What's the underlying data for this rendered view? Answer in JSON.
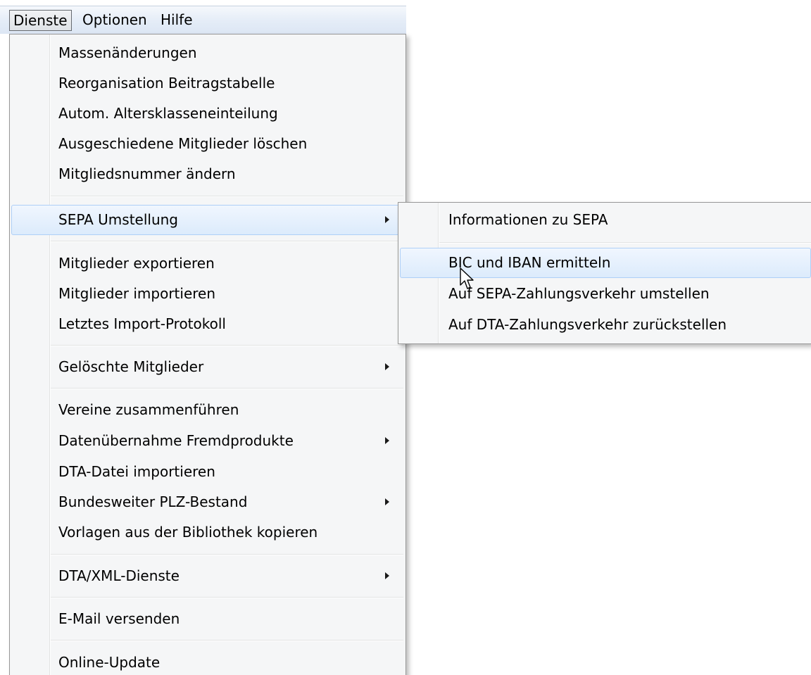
{
  "menubar": {
    "items": [
      {
        "label": "Dienste",
        "open": true
      },
      {
        "label": "Optionen",
        "open": false
      },
      {
        "label": "Hilfe",
        "open": false
      }
    ]
  },
  "dropdown": {
    "items": [
      {
        "label": "Massenänderungen"
      },
      {
        "label": "Reorganisation Beitragstabelle"
      },
      {
        "label": "Autom. Altersklasseneinteilung"
      },
      {
        "label": "Ausgeschiedene Mitglieder löschen"
      },
      {
        "label": "Mitgliedsnummer ändern"
      },
      {
        "label": "SEPA Umstellung",
        "submenu": true,
        "highlighted": true
      },
      {
        "label": "Mitglieder exportieren"
      },
      {
        "label": "Mitglieder importieren"
      },
      {
        "label": "Letztes Import-Protokoll"
      },
      {
        "label": "Gelöschte Mitglieder",
        "submenu": true
      },
      {
        "label": "Vereine zusammenführen"
      },
      {
        "label": "Datenübernahme Fremdprodukte",
        "submenu": true
      },
      {
        "label": "DTA-Datei importieren"
      },
      {
        "label": "Bundesweiter PLZ-Bestand",
        "submenu": true
      },
      {
        "label": "Vorlagen aus der Bibliothek kopieren"
      },
      {
        "label": "DTA/XML-Dienste",
        "submenu": true
      },
      {
        "label": "E-Mail versenden"
      },
      {
        "label": "Online-Update"
      }
    ]
  },
  "submenu": {
    "parent": "SEPA Umstellung",
    "items": [
      {
        "label": "Informationen zu SEPA"
      },
      {
        "label": "BIC und IBAN ermitteln",
        "highlighted": true
      },
      {
        "label": "Auf SEPA-Zahlungsverkehr umstellen"
      },
      {
        "label": "Auf DTA-Zahlungsverkehr zurückstellen"
      }
    ]
  },
  "icons": {
    "submenu_arrow": "chevron-right-icon",
    "cursor": "mouse-pointer-icon"
  },
  "colors": {
    "highlight_border": "#aecff7",
    "highlight_fill": "#dcebfc",
    "menu_background": "#f5f6f7",
    "menubar_background": "#e4ecf7"
  }
}
